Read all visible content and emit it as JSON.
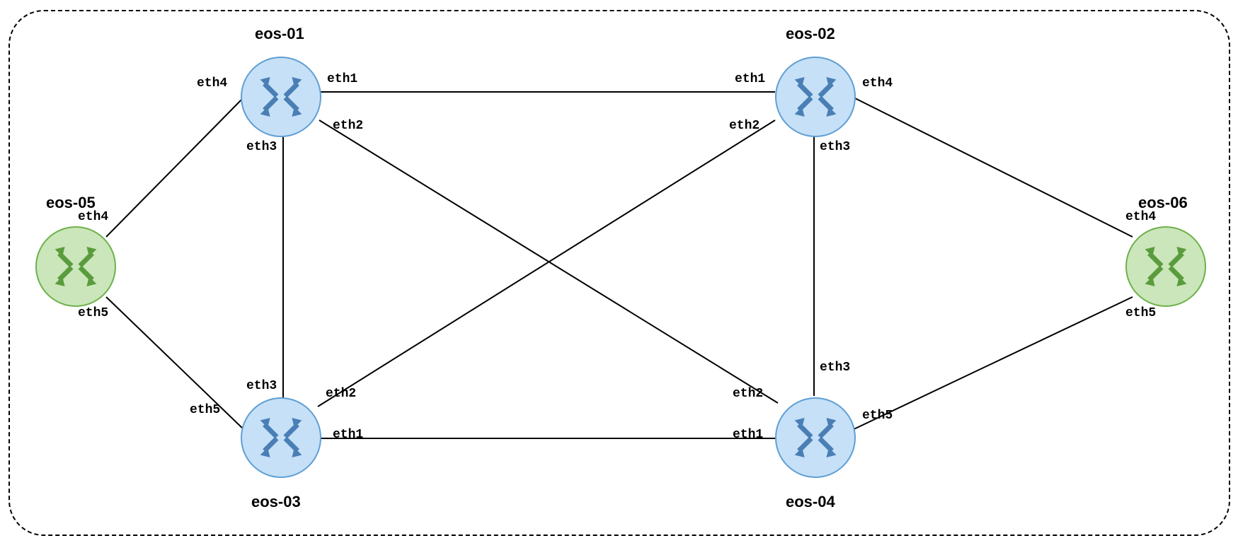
{
  "nodes": {
    "eos01": {
      "label": "eos-01"
    },
    "eos02": {
      "label": "eos-02"
    },
    "eos03": {
      "label": "eos-03"
    },
    "eos04": {
      "label": "eos-04"
    },
    "eos05": {
      "label": "eos-05"
    },
    "eos06": {
      "label": "eos-06"
    }
  },
  "ports": {
    "eos01_eth1": "eth1",
    "eos01_eth2": "eth2",
    "eos01_eth3": "eth3",
    "eos01_eth4": "eth4",
    "eos02_eth1": "eth1",
    "eos02_eth2": "eth2",
    "eos02_eth3": "eth3",
    "eos02_eth4": "eth4",
    "eos03_eth1": "eth1",
    "eos03_eth2": "eth2",
    "eos03_eth3": "eth3",
    "eos03_eth5": "eth5",
    "eos04_eth1": "eth1",
    "eos04_eth2": "eth2",
    "eos04_eth3": "eth3",
    "eos04_eth5": "eth5",
    "eos05_eth4": "eth4",
    "eos05_eth5": "eth5",
    "eos06_eth4": "eth4",
    "eos06_eth5": "eth5"
  },
  "colors": {
    "blue_fill": "#c6e0f7",
    "blue_stroke": "#5f9fd4",
    "blue_arrow": "#4a7fb5",
    "green_fill": "#cae6ba",
    "green_stroke": "#6fb14b",
    "green_arrow": "#5a9c3d"
  },
  "links": [
    {
      "from": "eos-01",
      "from_port": "eth1",
      "to": "eos-02",
      "to_port": "eth1"
    },
    {
      "from": "eos-01",
      "from_port": "eth2",
      "to": "eos-04",
      "to_port": "eth2"
    },
    {
      "from": "eos-01",
      "from_port": "eth3",
      "to": "eos-03",
      "to_port": "eth3"
    },
    {
      "from": "eos-01",
      "from_port": "eth4",
      "to": "eos-05",
      "to_port": "eth4"
    },
    {
      "from": "eos-02",
      "from_port": "eth2",
      "to": "eos-03",
      "to_port": "eth2"
    },
    {
      "from": "eos-02",
      "from_port": "eth3",
      "to": "eos-04",
      "to_port": "eth3"
    },
    {
      "from": "eos-02",
      "from_port": "eth4",
      "to": "eos-06",
      "to_port": "eth4"
    },
    {
      "from": "eos-03",
      "from_port": "eth1",
      "to": "eos-04",
      "to_port": "eth1"
    },
    {
      "from": "eos-03",
      "from_port": "eth5",
      "to": "eos-05",
      "to_port": "eth5"
    },
    {
      "from": "eos-04",
      "from_port": "eth5",
      "to": "eos-06",
      "to_port": "eth5"
    }
  ]
}
